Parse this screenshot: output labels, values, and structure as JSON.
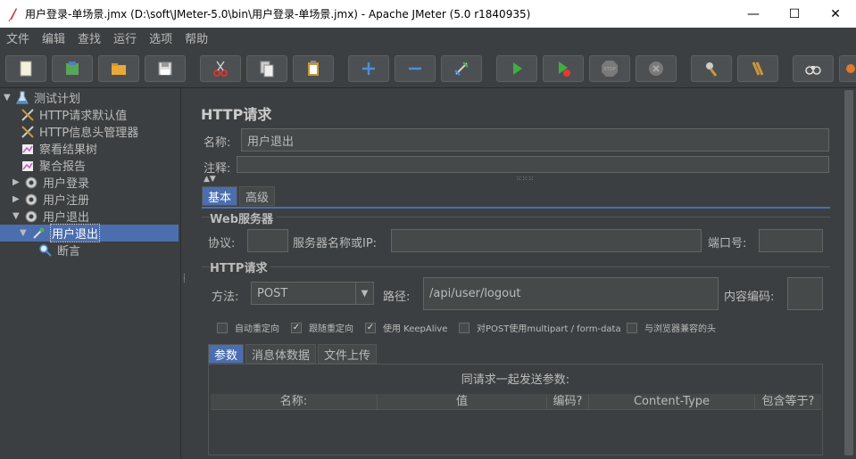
{
  "window": {
    "title": "用户登录-单场景.jmx (D:\\soft\\JMeter-5.0\\bin\\用户登录-单场景.jmx) - Apache JMeter (5.0 r1840935)",
    "minimize": "—",
    "maximize": "☐",
    "close": "✕"
  },
  "menu": [
    "文件",
    "编辑",
    "查找",
    "运行",
    "选项",
    "帮助"
  ],
  "toolbar": {
    "icons": [
      "new-icon",
      "templates-icon",
      "open-icon",
      "save-icon",
      "cut-icon",
      "copy-icon",
      "paste-icon",
      "expand-icon",
      "collapse-icon",
      "toggle-icon",
      "start-icon",
      "start-no-pause-icon",
      "stop-icon",
      "shutdown-icon",
      "clear-icon",
      "clear-all-icon",
      "search-icon",
      "reset-search-icon"
    ]
  },
  "tree": {
    "items": [
      {
        "label": "测试计划",
        "icon": "test-plan-icon",
        "expanded": true
      },
      {
        "label": "HTTP请求默认值",
        "icon": "config-icon"
      },
      {
        "label": "HTTP信息头管理器",
        "icon": "config-icon"
      },
      {
        "label": "察看结果树",
        "icon": "listener-icon"
      },
      {
        "label": "聚合报告",
        "icon": "listener-icon"
      },
      {
        "label": "用户登录",
        "icon": "thread-group-icon",
        "expanded": false
      },
      {
        "label": "用户注册",
        "icon": "thread-group-icon",
        "expanded": false
      },
      {
        "label": "用户退出",
        "icon": "thread-group-icon",
        "expanded": true
      },
      {
        "label": "用户退出",
        "icon": "sampler-icon",
        "selected": true,
        "expanded": true
      },
      {
        "label": "断言",
        "icon": "assertion-icon"
      }
    ]
  },
  "panel": {
    "title": "HTTP请求",
    "name_label": "名称:",
    "name_value": "用户退出",
    "comment_label": "注释:",
    "comment_value": "",
    "tabs": [
      "基本",
      "高级"
    ],
    "web_server": {
      "title": "Web服务器",
      "protocol_label": "协议:",
      "protocol_value": "",
      "server_label": "服务器名称或IP:",
      "server_value": "",
      "port_label": "端口号:",
      "port_value": ""
    },
    "http_request": {
      "title": "HTTP请求",
      "method_label": "方法:",
      "method_value": "POST",
      "path_label": "路径:",
      "path_value": "/api/user/logout",
      "encoding_label": "内容编码:",
      "encoding_value": ""
    },
    "checkboxes": [
      {
        "label": "自动重定向",
        "checked": false
      },
      {
        "label": "跟随重定向",
        "checked": true
      },
      {
        "label": "使用 KeepAlive",
        "checked": true
      },
      {
        "label": "对POST使用multipart / form-data",
        "checked": false
      },
      {
        "label": "与浏览器兼容的头",
        "checked": false
      }
    ],
    "param_tabs": [
      "参数",
      "消息体数据",
      "文件上传"
    ],
    "params_caption": "同请求一起发送参数:",
    "params_columns": [
      "名称:",
      "值",
      "编码?",
      "Content-Type",
      "包含等于?"
    ]
  },
  "colors": {
    "background": "#3c3f41",
    "selection": "#4b6eaf",
    "green_run": "#4caf50"
  }
}
